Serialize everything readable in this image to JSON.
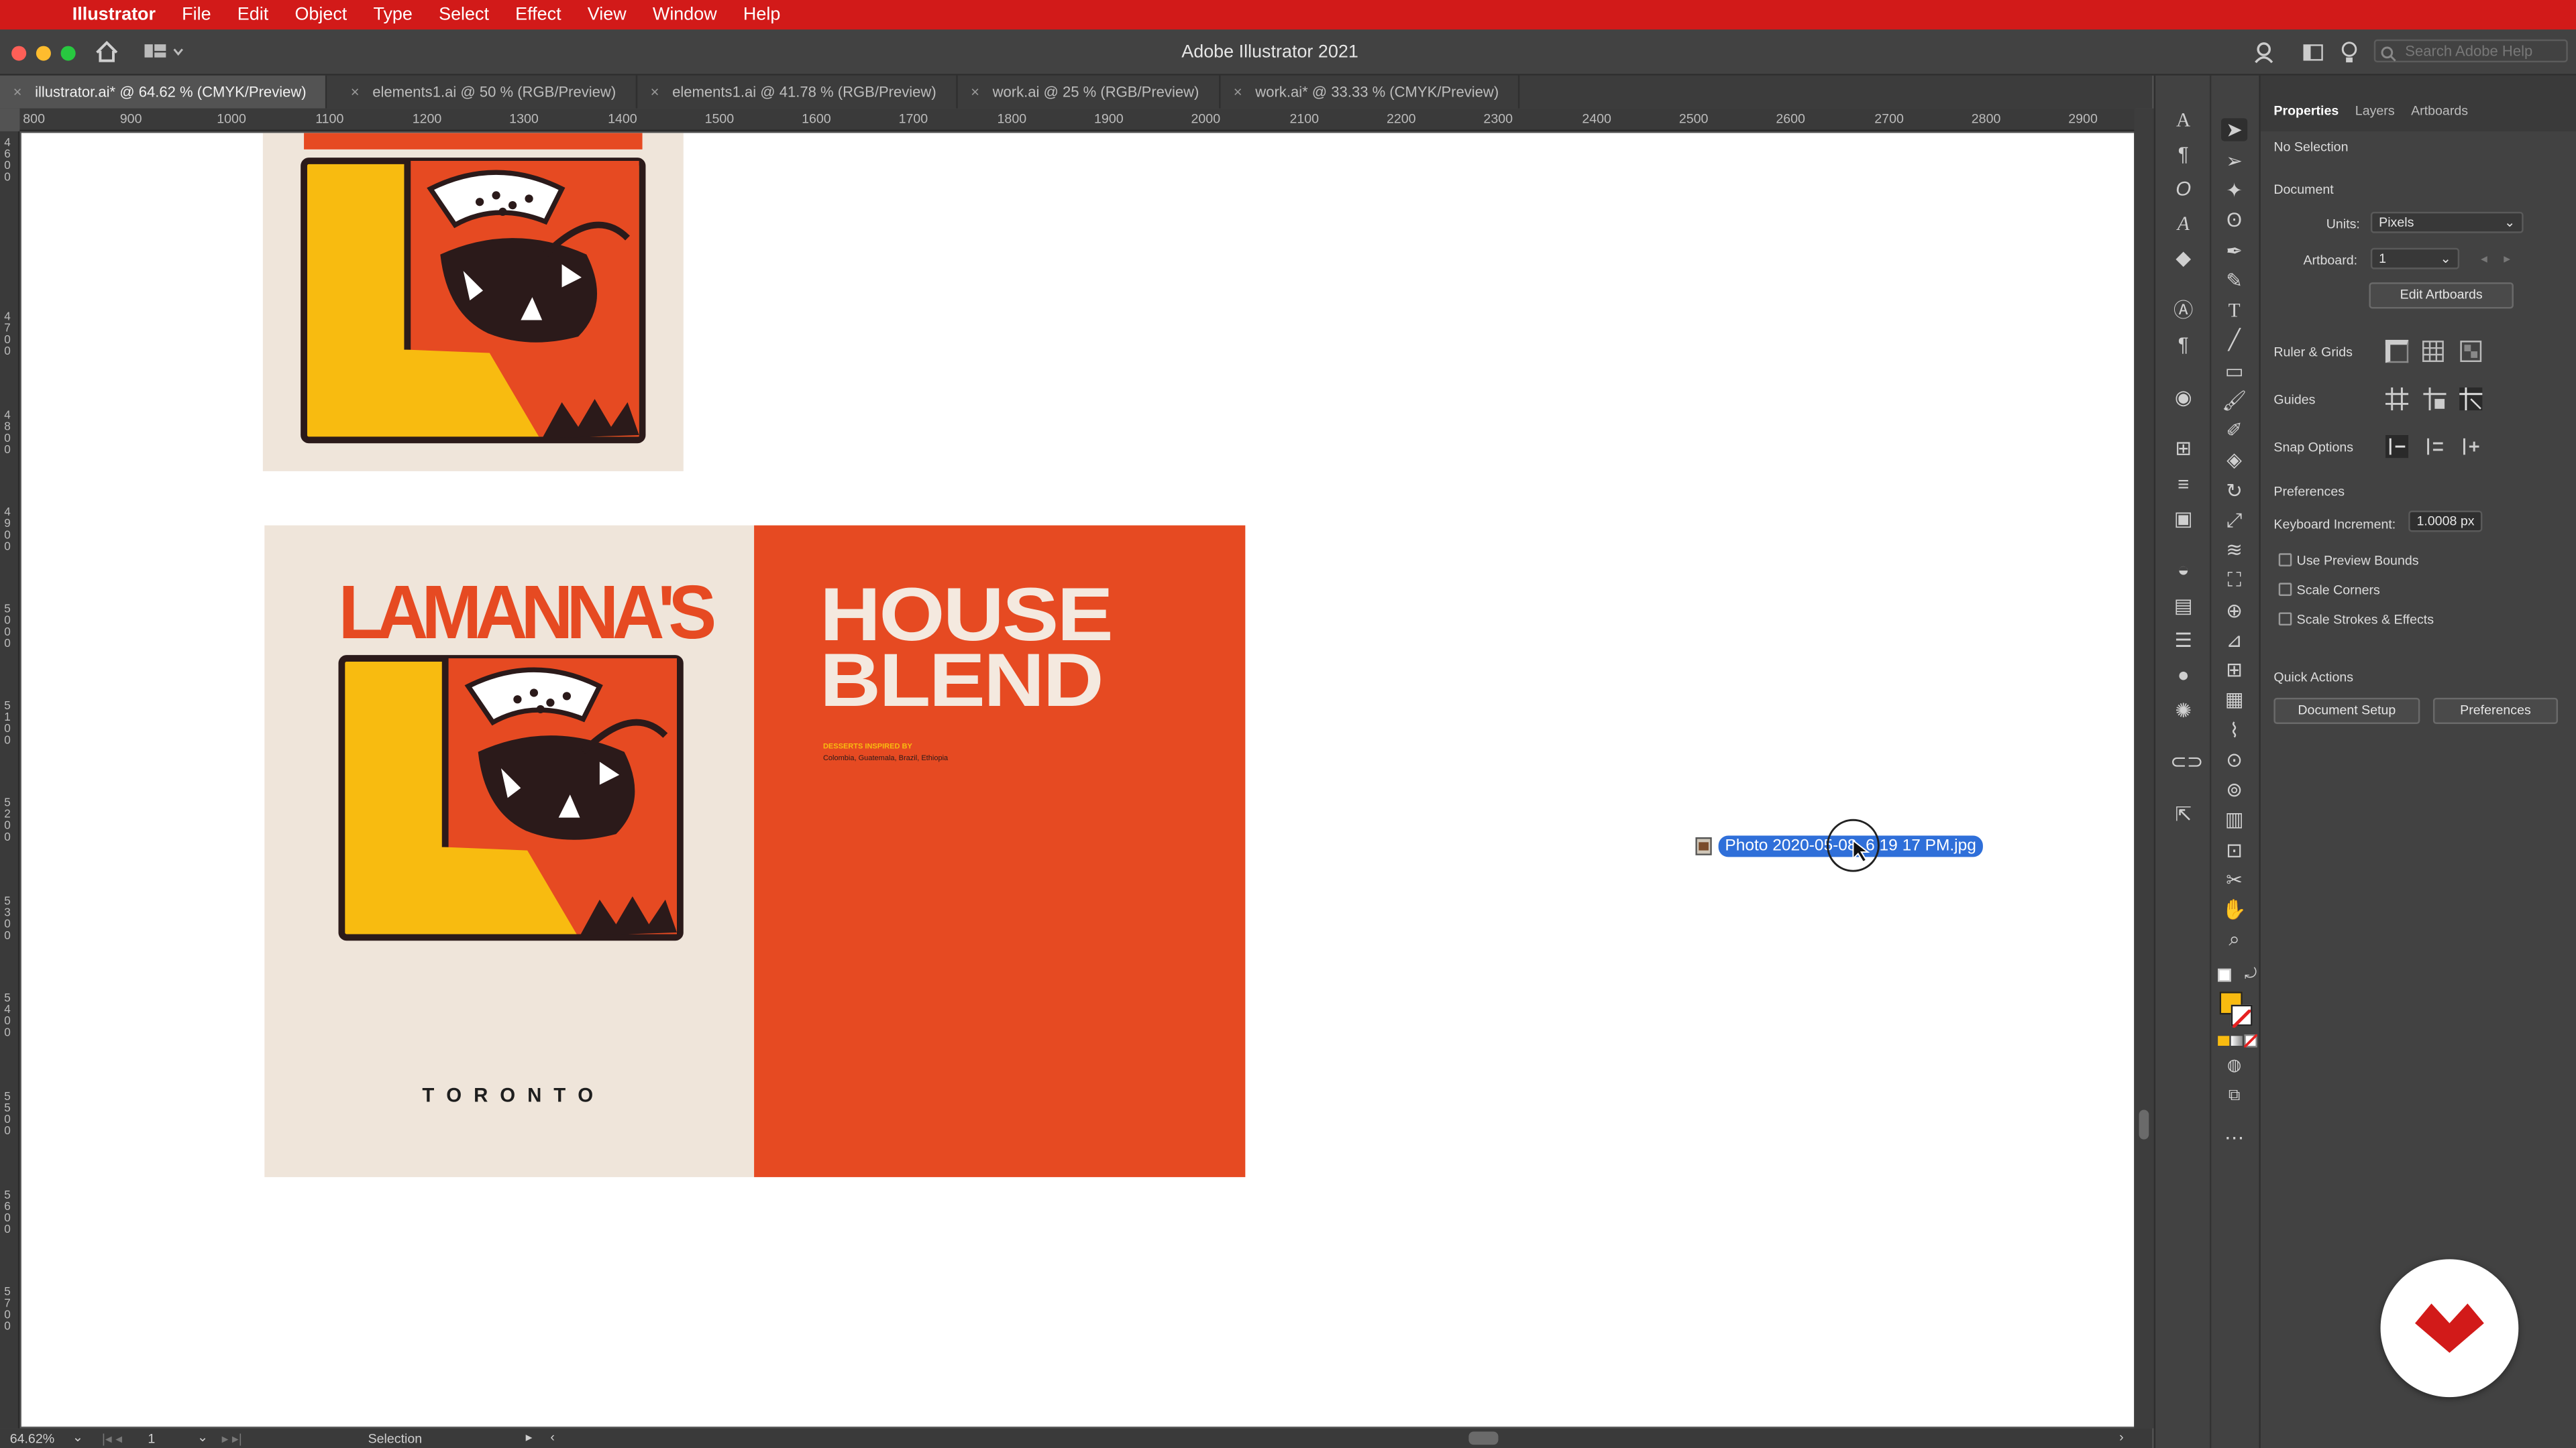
{
  "menubar": {
    "app": "Illustrator",
    "items": [
      "File",
      "Edit",
      "Object",
      "Type",
      "Select",
      "Effect",
      "View",
      "Window",
      "Help"
    ]
  },
  "window": {
    "title": "Adobe Illustrator 2021",
    "search_placeholder": "Search Adobe Help"
  },
  "tabs": [
    {
      "label": "illustrator.ai* @ 64.62 % (CMYK/Preview)",
      "active": true
    },
    {
      "label": "elements1.ai @ 50 % (RGB/Preview)",
      "active": false
    },
    {
      "label": "elements1.ai @ 41.78 % (RGB/Preview)",
      "active": false
    },
    {
      "label": "work.ai @ 25 % (RGB/Preview)",
      "active": false
    },
    {
      "label": "work.ai* @ 33.33 % (CMYK/Preview)",
      "active": false
    }
  ],
  "ruler": {
    "horizontal": [
      "800",
      "900",
      "1000",
      "1100",
      "1200",
      "1300",
      "1400",
      "1500",
      "1600",
      "1700",
      "1800",
      "1900",
      "2000",
      "2100",
      "2200",
      "2300",
      "2400",
      "2500",
      "2600",
      "2700",
      "2800",
      "2900"
    ],
    "vertical": [
      "4600",
      "4700",
      "4800",
      "4900",
      "5000",
      "5100",
      "5200",
      "5300",
      "5400",
      "5500",
      "5600",
      "5700"
    ]
  },
  "artwork": {
    "brand": "LAMANNA'S",
    "city": "T O R O N T O",
    "headline_1": "HOUSE",
    "headline_2": "BLEND",
    "sub_1": "DESSERTS INSPIRED BY",
    "sub_2": "Colombia, Guatemala, Brazil, Ethiopia"
  },
  "drag_file": "Photo 2020-05-08, 6 19 17 PM.jpg",
  "status": {
    "zoom": "64.62%",
    "artboard": "1",
    "tool": "Selection"
  },
  "panel": {
    "tabs": [
      "Properties",
      "Layers",
      "Artboards"
    ],
    "no_selection": "No Selection",
    "document": "Document",
    "units_label": "Units:",
    "units_value": "Pixels",
    "artboard_label": "Artboard:",
    "artboard_value": "1",
    "edit_artboards": "Edit Artboards",
    "ruler_grids": "Ruler & Grids",
    "guides": "Guides",
    "snap_options": "Snap Options",
    "preferences_header": "Preferences",
    "keyboard_increment_label": "Keyboard Increment:",
    "keyboard_increment_value": "1.0008 px",
    "use_preview_bounds": "Use Preview Bounds",
    "scale_corners": "Scale Corners",
    "scale_strokes": "Scale Strokes & Effects",
    "quick_actions": "Quick Actions",
    "document_setup": "Document Setup",
    "preferences_button": "Preferences"
  },
  "colors": {
    "menubar": "#d21a19",
    "orange": "#e64a22",
    "cream": "#efe5da",
    "yellow": "#f8bb10",
    "dark": "#2b1a1a",
    "selection": "#2f6fd9"
  }
}
